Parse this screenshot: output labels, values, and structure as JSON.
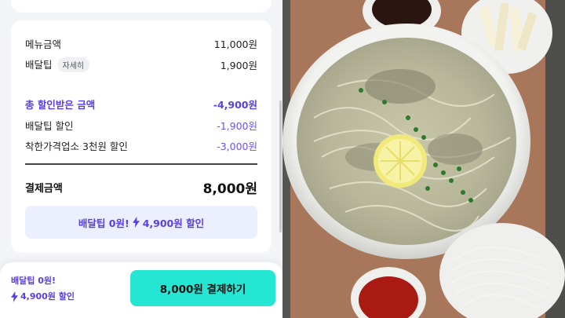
{
  "order": {
    "menu_label": "메뉴금액",
    "menu_value": "11,000원",
    "delivery_label": "배달팁",
    "detail_chip": "자세히",
    "delivery_value": "1,900원",
    "discount_total_label": "총 할인받은 금액",
    "discount_total_value": "-4,900원",
    "delivery_discount_label": "배달팁 할인",
    "delivery_discount_value": "-1,900원",
    "store_discount_label": "착한가격업소 3천원 할인",
    "store_discount_value": "-3,000원",
    "payment_label": "결제금액",
    "payment_value": "8,000원"
  },
  "promo": {
    "text_a": "배달팁 0원!",
    "text_b": "4,900원 할인"
  },
  "bottom": {
    "line1": "배달팁 0원!",
    "line2": "4,900원 할인",
    "pay_button": "8,000원 결제하기"
  },
  "colors": {
    "accent_purple": "#5a3fe0",
    "pay_button": "#24e6d3",
    "promo_bg": "#eceffd"
  },
  "icons": [
    "lightning-bolt-icon"
  ],
  "photo": {
    "subject": "beef pho with lemon slice, rice noodles, pickled radish and sauces"
  }
}
